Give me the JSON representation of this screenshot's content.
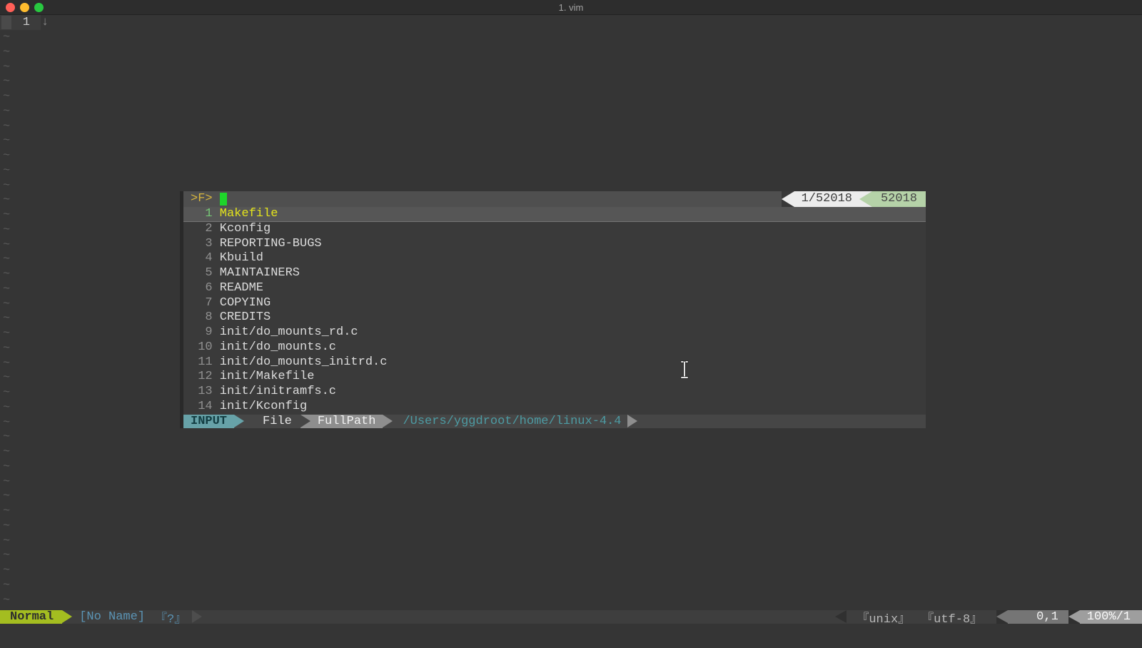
{
  "window": {
    "title": "1. vim"
  },
  "editor": {
    "line_number": "1",
    "wrap_arrow": "↓",
    "tilde": "~",
    "tilde_count": 39
  },
  "finder": {
    "prompt": ">F>",
    "count_position": "1/52018",
    "count_total": "52018",
    "files": [
      {
        "num": "1",
        "name": "Makefile",
        "selected": true
      },
      {
        "num": "2",
        "name": "Kconfig"
      },
      {
        "num": "3",
        "name": "REPORTING-BUGS"
      },
      {
        "num": "4",
        "name": "Kbuild"
      },
      {
        "num": "5",
        "name": "MAINTAINERS"
      },
      {
        "num": "6",
        "name": "README"
      },
      {
        "num": "7",
        "name": "COPYING"
      },
      {
        "num": "8",
        "name": "CREDITS"
      },
      {
        "num": "9",
        "name": "init/do_mounts_rd.c"
      },
      {
        "num": "10",
        "name": "init/do_mounts.c"
      },
      {
        "num": "11",
        "name": "init/do_mounts_initrd.c"
      },
      {
        "num": "12",
        "name": "init/Makefile"
      },
      {
        "num": "13",
        "name": "init/initramfs.c"
      },
      {
        "num": "14",
        "name": "init/Kconfig"
      }
    ],
    "statusline": {
      "mode": "INPUT",
      "category": "File",
      "matcher": "FullPath",
      "cwd": "/Users/yggdroot/home/linux-4.4"
    }
  },
  "statusline": {
    "mode": "Normal",
    "filename": "[No Name]",
    "filetype": "『?』",
    "fileformat": "『unix』",
    "encoding": "『utf-8』",
    "position": "0,1",
    "scroll": "100%/1"
  },
  "colors": {
    "cursor_green": "#1ed52a",
    "selected_file_yellow": "#e3e31c",
    "prompt_yellow": "#d8b73e",
    "mode_normal_bg": "#a4bd20",
    "mode_input_bg": "#67a2a8",
    "count_total_bg": "#b5d2a8",
    "path_teal": "#4d9ba3"
  }
}
